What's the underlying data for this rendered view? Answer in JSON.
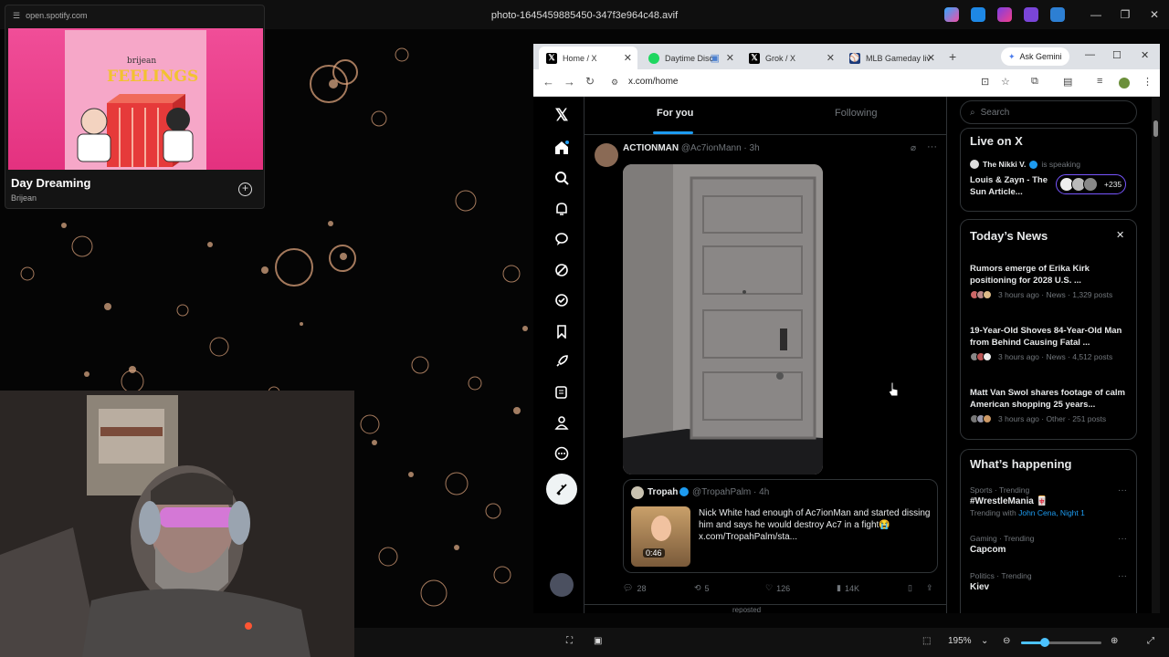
{
  "viewer": {
    "spotify_url": "open.spotify.com",
    "file_name": "photo-1645459885450-347f3e964c48.avif",
    "zoom": "195%"
  },
  "spotify": {
    "cover_brand": "brijean",
    "cover_title": "FEELINGS",
    "song": "Day Dreaming",
    "artist": "Brijean"
  },
  "browser": {
    "tabs": [
      {
        "label": "Home / X",
        "active": true
      },
      {
        "label": "Daytime Disc",
        "active": false
      },
      {
        "label": "Grok / X",
        "active": false
      },
      {
        "label": "MLB Gameday liv",
        "active": false
      }
    ],
    "ask_gemini": "Ask Gemini",
    "url": "x.com/home"
  },
  "timeline": {
    "tabs": [
      "For you",
      "Following"
    ],
    "post": {
      "name": "ACTIONMAN",
      "handle": "@Ac7ionMann · 3h"
    },
    "quote": {
      "name": "Tropah",
      "handle": "@TropahPalm · 4h",
      "text": "Nick White had enough of Ac7ionMan and started dissing him and says he would destroy Ac7 in a fight😭",
      "link": "x.com/TropahPalm/sta...",
      "duration": "0:46"
    },
    "stats": {
      "replies": "28",
      "reposts": "5",
      "likes": "126",
      "views": "14K"
    },
    "next_post": "reposted"
  },
  "sidebar": {
    "search_placeholder": "Search",
    "live": {
      "title": "Live on X",
      "host": "The Nikki V.",
      "speaking": "is speaking",
      "space": "Louis & Zayn - The Sun Article...",
      "count": "+235"
    },
    "news": {
      "title": "Today’s News",
      "items": [
        {
          "headline": "Rumors emerge of Erika Kirk positioning for 2028 U.S. ...",
          "meta": "3 hours ago · News · 1,329 posts"
        },
        {
          "headline": "19-Year-Old Shoves 84-Year-Old Man from Behind Causing Fatal ...",
          "meta": "3 hours ago · News · 4,512 posts"
        },
        {
          "headline": "Matt Van Swol shares footage of calm American shopping 25 years...",
          "meta": "3 hours ago · Other · 251 posts"
        }
      ]
    },
    "happening": {
      "title": "What’s happening",
      "items": [
        {
          "category": "Sports · Trending",
          "topic": "#WrestleMania 🀄",
          "with_label": "Trending with",
          "with_tags": "John Cena, Night 1"
        },
        {
          "category": "Gaming · Trending",
          "topic": "Capcom"
        },
        {
          "category": "Politics · Trending",
          "topic": "Kiev"
        }
      ]
    }
  },
  "colors": {
    "x_blue": "#1d9bf0",
    "spotify_pink": "#e8378a",
    "bg": "#000000"
  }
}
